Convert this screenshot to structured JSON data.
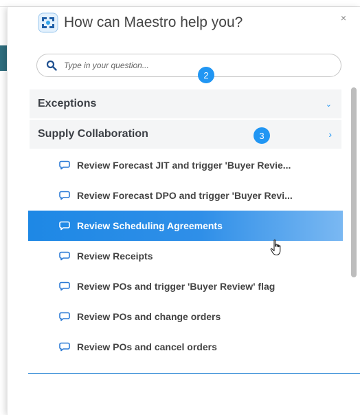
{
  "header": {
    "title": "How can Maestro help you?",
    "close_label": "×"
  },
  "search": {
    "placeholder": "Type in your question...",
    "value": ""
  },
  "badges": {
    "search": "2",
    "section": "3"
  },
  "sections": [
    {
      "label": "Exceptions",
      "chevron": "⌄"
    },
    {
      "label": "Supply Collaboration",
      "chevron": "›"
    }
  ],
  "items": [
    {
      "label": "Review Forecast JIT and trigger 'Buyer Revie..."
    },
    {
      "label": "Review Forecast DPO and trigger 'Buyer Revi..."
    },
    {
      "label": "Review Scheduling Agreements"
    },
    {
      "label": "Review Receipts"
    },
    {
      "label": "Review POs and trigger 'Buyer Review' flag"
    },
    {
      "label": "Review POs and change orders"
    },
    {
      "label": "Review POs and cancel orders"
    }
  ],
  "selected_item": 2,
  "colors": {
    "accent": "#2196f3",
    "active": "#1e88e5",
    "section_bg": "#f4f5f6"
  },
  "icons": {
    "logo": "maestro-logo-icon",
    "search": "search-icon",
    "item": "chat-bubble-icon",
    "cursor": "hand-pointer-icon"
  }
}
